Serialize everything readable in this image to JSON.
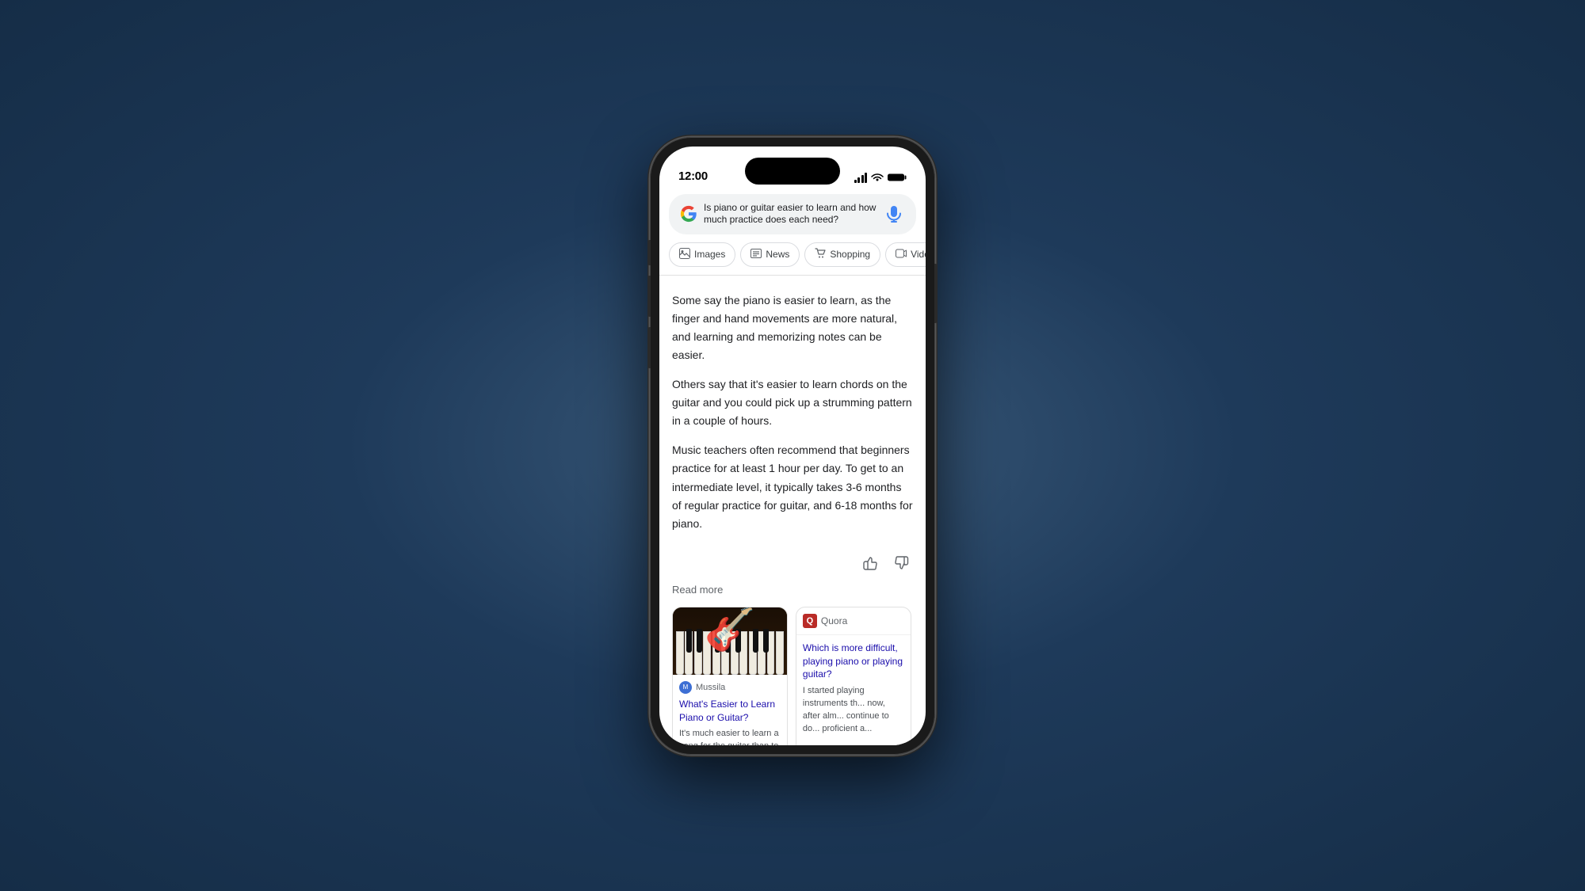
{
  "phone": {
    "status_bar": {
      "time": "12:00"
    },
    "search": {
      "query": "Is piano or guitar easier to learn and how much practice does each need?"
    },
    "tabs": [
      {
        "label": "Images",
        "icon": "🖼"
      },
      {
        "label": "News",
        "icon": "📰"
      },
      {
        "label": "Shopping",
        "icon": "🛍"
      },
      {
        "label": "Videos",
        "icon": "▶"
      }
    ],
    "ai_answer": {
      "paragraph1": "Some say the piano is easier to learn, as the finger and hand movements are more natural, and learning and memorizing notes can be easier.",
      "paragraph2": "Others say that it's easier to learn chords on the guitar and you could pick up a strumming pattern in a couple of hours.",
      "paragraph3": "Music teachers often recommend that beginners practice for at least 1 hour per day. To get to an intermediate level, it typically takes 3-6 months of regular practice for guitar, and 6-18 months for piano."
    },
    "read_more_label": "Read more",
    "cards": [
      {
        "source_name": "Mussila",
        "title": "What's Easier to Learn Piano or Guitar?",
        "snippet": "It's much easier to learn a song for the guitar than to learn it for"
      },
      {
        "source_name": "Quora",
        "title": "Which is more difficult, playing piano or playing guitar?",
        "snippet": "I started playing instruments th... now, after alm... continue to do... proficient a..."
      }
    ]
  }
}
